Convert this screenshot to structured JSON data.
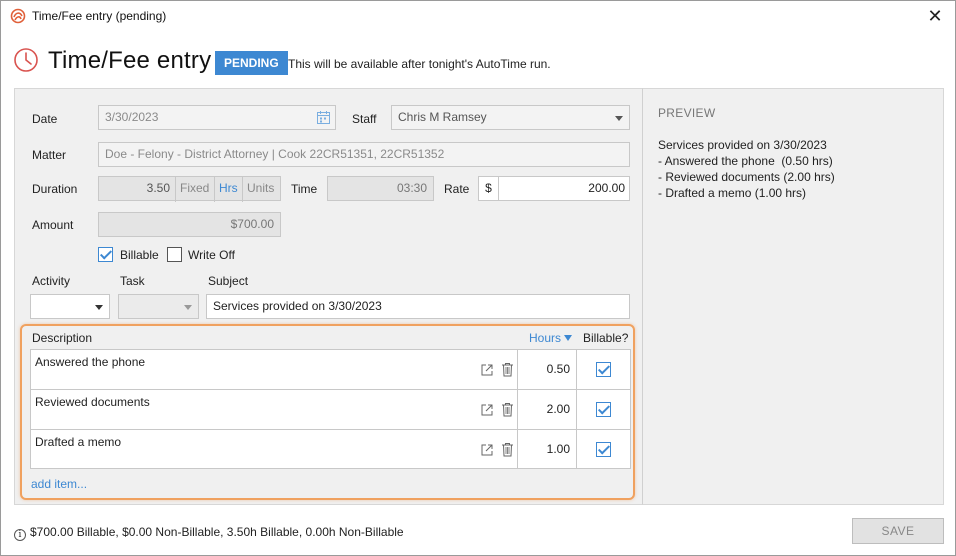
{
  "window": {
    "title": "Time/Fee entry (pending)",
    "close": "✕"
  },
  "header": {
    "title": "Time/Fee entry",
    "badge": "PENDING",
    "message": "This will be available after tonight's AutoTime run."
  },
  "form": {
    "date_label": "Date",
    "date_value": "3/30/2023",
    "staff_label": "Staff",
    "staff_value": "Chris M Ramsey",
    "matter_label": "Matter",
    "matter_value": "Doe - Felony - District Attorney | Cook 22CR51351, 22CR51352",
    "duration_label": "Duration",
    "duration_value": "3.50",
    "duration_modes": [
      "Fixed",
      "Hrs",
      "Units"
    ],
    "duration_active": "Hrs",
    "time_label": "Time",
    "time_value": "03:30",
    "rate_label": "Rate",
    "rate_currency": "$",
    "rate_value": "200.00",
    "amount_label": "Amount",
    "amount_value": "$700.00",
    "billable_label": "Billable",
    "billable_checked": true,
    "writeoff_label": "Write Off",
    "writeoff_checked": false,
    "activity_label": "Activity",
    "activity_value": "",
    "task_label": "Task",
    "task_value": "",
    "subject_label": "Subject",
    "subject_value": "Services provided on 3/30/2023"
  },
  "items": {
    "col_description": "Description",
    "col_hours": "Hours",
    "col_billable": "Billable?",
    "rows": [
      {
        "description": "Answered the phone",
        "hours": "0.50",
        "billable": true
      },
      {
        "description": "Reviewed documents",
        "hours": "2.00",
        "billable": true
      },
      {
        "description": "Drafted a memo",
        "hours": "1.00",
        "billable": true
      }
    ],
    "add_item": "add item..."
  },
  "preview": {
    "title": "PREVIEW",
    "lines": [
      "Services provided on 3/30/2023",
      "- Answered the phone  (0.50 hrs)",
      "- Reviewed documents (2.00 hrs)",
      "- Drafted a memo (1.00 hrs)"
    ]
  },
  "footer": {
    "summary": "$700.00 Billable, $0.00 Non-Billable, 3.50h Billable, 0.00h Non-Billable",
    "save_label": "SAVE"
  },
  "colors": {
    "accent": "#3d88d2",
    "highlight_border": "#f0a15f",
    "logo": "#e0603a",
    "clock": "#d9534f"
  }
}
